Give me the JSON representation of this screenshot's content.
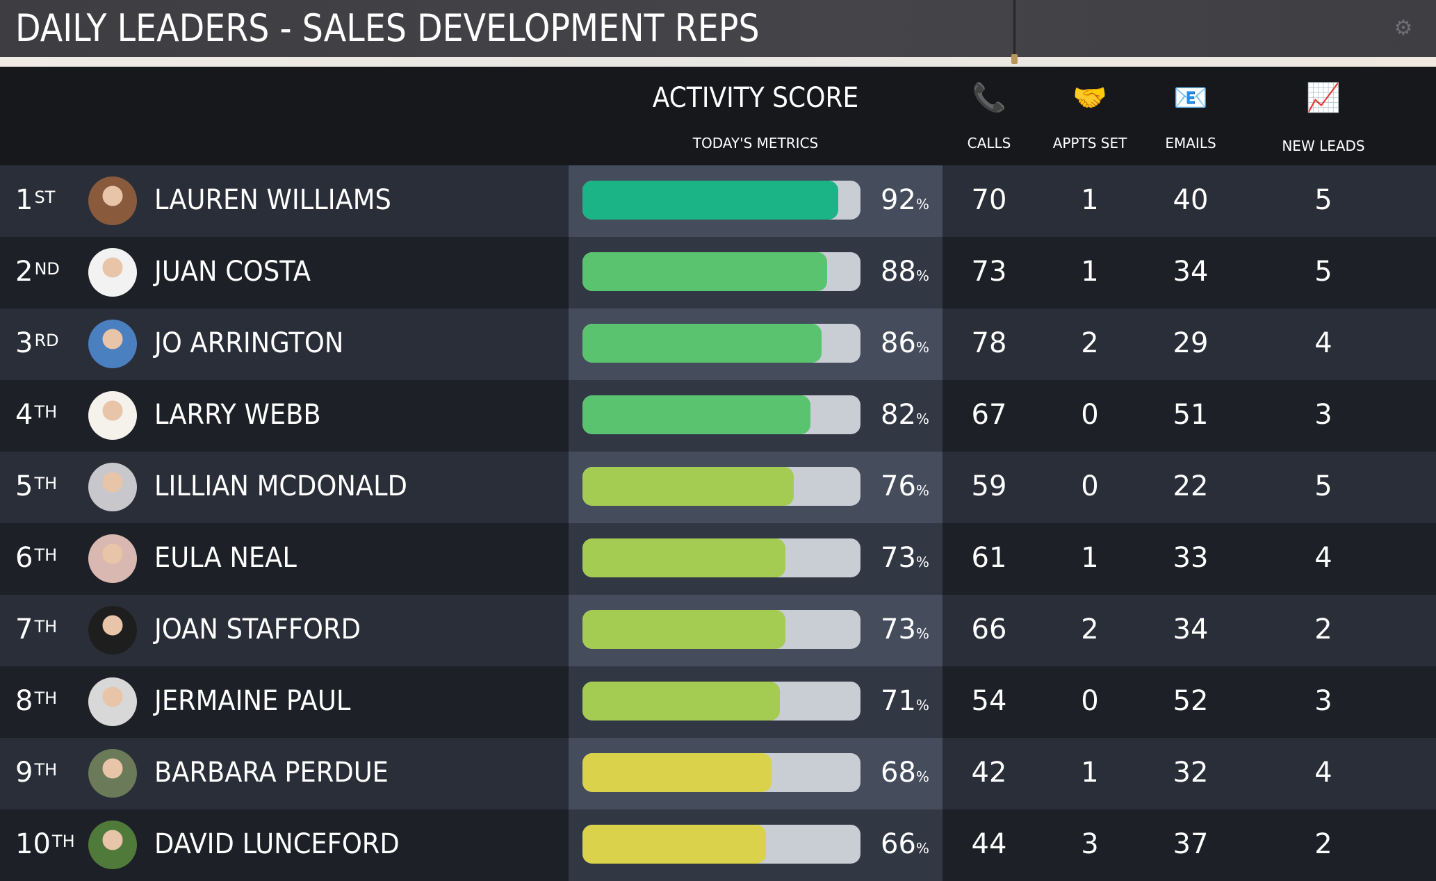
{
  "title": "DAILY LEADERS - SALES DEVELOPMENT REPS",
  "settings_icon": "gear-icon",
  "header": {
    "activity_score": "ACTIVITY SCORE",
    "todays_metrics": "TODAY'S METRICS",
    "columns": [
      {
        "key": "calls",
        "label": "CALLS",
        "icon": "telephone-icon",
        "glyph": "📞"
      },
      {
        "key": "appts",
        "label": "APPTS SET",
        "icon": "handshake-icon",
        "glyph": "🤝"
      },
      {
        "key": "emails",
        "label": "EMAILS",
        "icon": "email-icon",
        "glyph": "📧"
      },
      {
        "key": "leads",
        "label": "NEW LEADS",
        "icon": "chart-increasing-icon",
        "glyph": "📈"
      }
    ]
  },
  "colors": {
    "track": "#c9cdd4",
    "teal": "#1bb487",
    "green": "#59c36f",
    "lime": "#a4cb52",
    "yellow": "#d9d24a"
  },
  "leaders": [
    {
      "rank": "1",
      "suffix": "ST",
      "name": "LAUREN WILLIAMS",
      "score": 92,
      "pct_sign": "%",
      "bar_color": "#1bb487",
      "calls": "70",
      "appts": "1",
      "emails": "40",
      "leads": "5",
      "avatar_tone": "#8a5a3c"
    },
    {
      "rank": "2",
      "suffix": "ND",
      "name": "JUAN COSTA",
      "score": 88,
      "pct_sign": "%",
      "bar_color": "#59c36f",
      "calls": "73",
      "appts": "1",
      "emails": "34",
      "leads": "5",
      "avatar_tone": "#f2f2f2"
    },
    {
      "rank": "3",
      "suffix": "RD",
      "name": "JO ARRINGTON",
      "score": 86,
      "pct_sign": "%",
      "bar_color": "#59c36f",
      "calls": "78",
      "appts": "2",
      "emails": "29",
      "leads": "4",
      "avatar_tone": "#4a7fc0"
    },
    {
      "rank": "4",
      "suffix": "TH",
      "name": "LARRY WEBB",
      "score": 82,
      "pct_sign": "%",
      "bar_color": "#59c36f",
      "calls": "67",
      "appts": "0",
      "emails": "51",
      "leads": "3",
      "avatar_tone": "#f5f2ec"
    },
    {
      "rank": "5",
      "suffix": "TH",
      "name": "LILLIAN MCDONALD",
      "score": 76,
      "pct_sign": "%",
      "bar_color": "#a4cb52",
      "calls": "59",
      "appts": "0",
      "emails": "22",
      "leads": "5",
      "avatar_tone": "#c8c8cc"
    },
    {
      "rank": "6",
      "suffix": "TH",
      "name": "EULA NEAL",
      "score": 73,
      "pct_sign": "%",
      "bar_color": "#a4cb52",
      "calls": "61",
      "appts": "1",
      "emails": "33",
      "leads": "4",
      "avatar_tone": "#d8b8b0"
    },
    {
      "rank": "7",
      "suffix": "TH",
      "name": "JOAN STAFFORD",
      "score": 73,
      "pct_sign": "%",
      "bar_color": "#a4cb52",
      "calls": "66",
      "appts": "2",
      "emails": "34",
      "leads": "2",
      "avatar_tone": "#1e1e1e"
    },
    {
      "rank": "8",
      "suffix": "TH",
      "name": "JERMAINE PAUL",
      "score": 71,
      "pct_sign": "%",
      "bar_color": "#a4cb52",
      "calls": "54",
      "appts": "0",
      "emails": "52",
      "leads": "3",
      "avatar_tone": "#d8d8d8"
    },
    {
      "rank": "9",
      "suffix": "TH",
      "name": "BARBARA PERDUE",
      "score": 68,
      "pct_sign": "%",
      "bar_color": "#d9d24a",
      "calls": "42",
      "appts": "1",
      "emails": "32",
      "leads": "4",
      "avatar_tone": "#6b7a58"
    },
    {
      "rank": "10",
      "suffix": "TH",
      "name": "DAVID LUNCEFORD",
      "score": 66,
      "pct_sign": "%",
      "bar_color": "#d9d24a",
      "calls": "44",
      "appts": "3",
      "emails": "37",
      "leads": "2",
      "avatar_tone": "#4f7a3a"
    }
  ]
}
